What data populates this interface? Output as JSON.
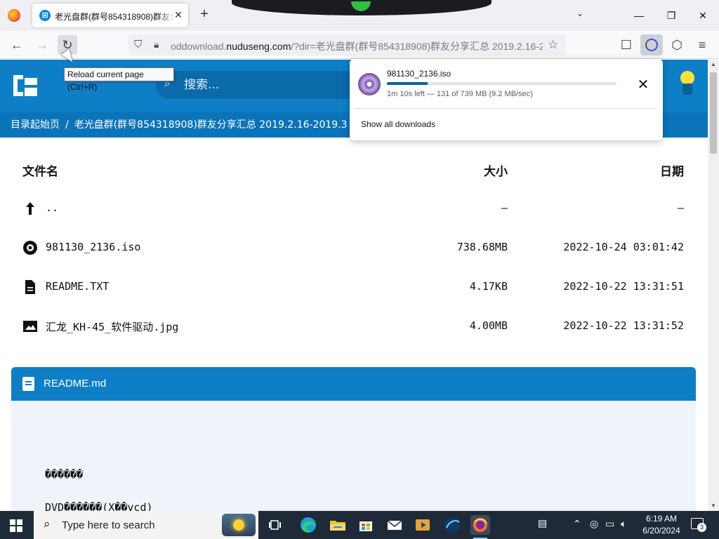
{
  "browser": {
    "tab": {
      "title": "老光盘群(群号854318908)群友分享汇总",
      "favicon": "site-icon"
    },
    "url": {
      "prefix": "oddownload.",
      "domain": "nuduseng.com",
      "rest": "/?dir=老光盘群(群号854318908)群友分享汇总 2019.2.16-2"
    },
    "tooltip": "Reload current page (Ctrl+R)",
    "icons": {
      "back": "←",
      "forward": "→",
      "reload": "↻",
      "shield": "⛉",
      "lock": "🔒︎",
      "star": "☆",
      "pocket": "☐",
      "extensions": "⬡",
      "menu": "≡",
      "tab_close": "✕",
      "new_tab": "+",
      "tablist": "⌄",
      "minimize": "—",
      "maximize": "❐",
      "close": "✕"
    }
  },
  "download_panel": {
    "filename": "981130_2136.iso",
    "status": "1m 10s left — 131 of 739 MB (9.2 MB/sec)",
    "progress_percent": 17.7,
    "show_all": "Show all downloads",
    "close_icon": "✕"
  },
  "site": {
    "search_placeholder": "搜索...",
    "search_icon": "⌕",
    "breadcrumb": {
      "home": "目录起始页",
      "sep": "/",
      "current": "老光盘群(群号854318908)群友分享汇总 2019.2.16-2019.3"
    }
  },
  "table": {
    "headers": {
      "name": "文件名",
      "size": "大小",
      "date": "日期"
    },
    "rows": [
      {
        "icon": "parent-dir-icon",
        "name": "..",
        "size": "—",
        "date": "—"
      },
      {
        "icon": "disc-icon",
        "name": "981130_2136.iso",
        "size": "738.68MB",
        "date": "2022-10-24 03:01:42"
      },
      {
        "icon": "document-icon",
        "name": "README.TXT",
        "size": "4.17KB",
        "date": "2022-10-22 13:31:51"
      },
      {
        "icon": "image-icon",
        "name": "汇龙_KH-45_软件驱动.jpg",
        "size": "4.00MB",
        "date": "2022-10-22 13:31:52"
      }
    ]
  },
  "readme": {
    "title": "README.md",
    "lines": [
      "������",
      "DVD������(X��vcd)"
    ]
  },
  "taskbar": {
    "search_placeholder": "Type here to search",
    "time": "6:19 AM",
    "date": "6/20/2024",
    "notification_count": "3"
  }
}
